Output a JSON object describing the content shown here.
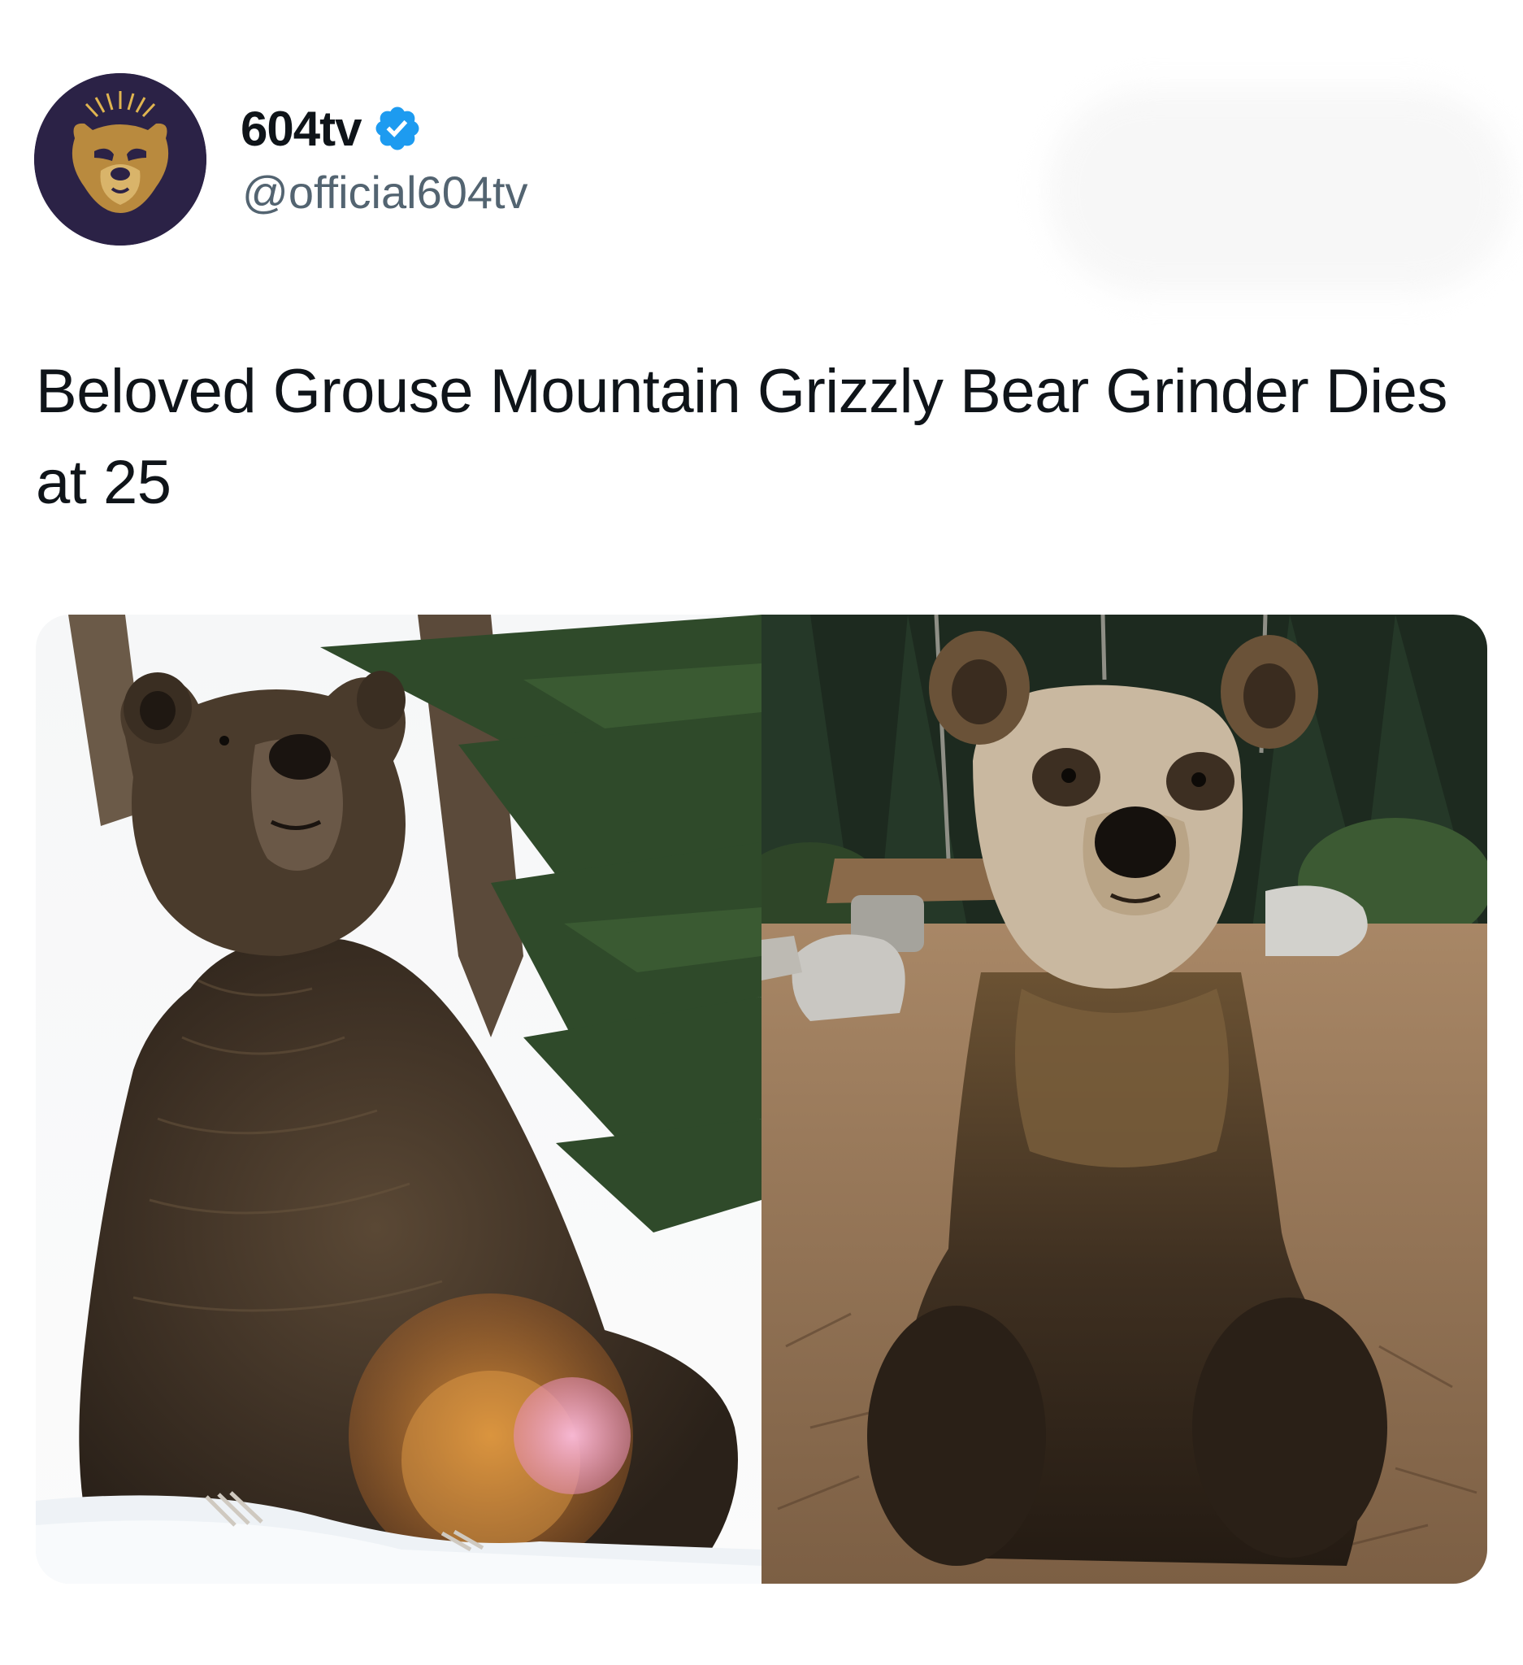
{
  "tweet": {
    "author": {
      "display_name": "604tv",
      "handle": "@official604tv",
      "verified": true,
      "avatar_icon": "bear-logo-icon",
      "avatar_bg": "#2b2246",
      "avatar_accent": "#c9a24b"
    },
    "text": "Beloved Grouse Mountain Grizzly Bear Grinder Dies at 25",
    "media": {
      "count": 2,
      "items": [
        {
          "icon": "bear-in-snow-photo"
        },
        {
          "icon": "bear-sitting-in-forest-photo"
        }
      ]
    }
  },
  "colors": {
    "text_primary": "#0f1419",
    "text_secondary": "#536471",
    "verified_blue": "#1d9bf0"
  }
}
